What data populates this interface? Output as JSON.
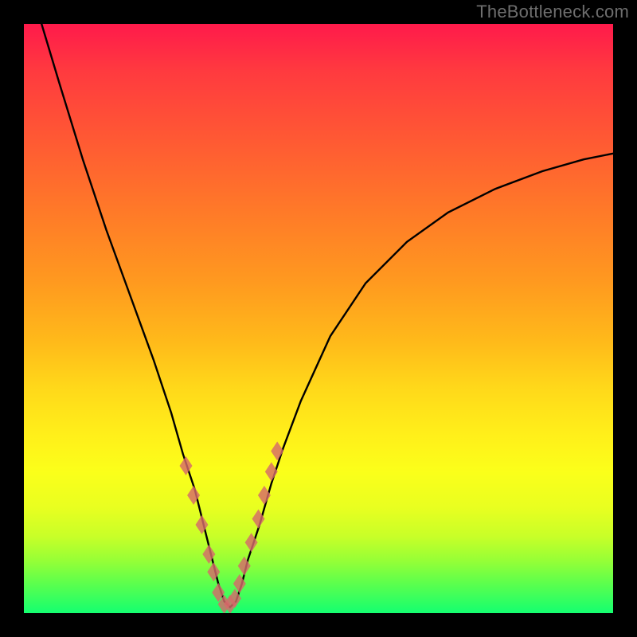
{
  "watermark": "TheBottleneck.com",
  "colors": {
    "frame": "#000000",
    "curve": "#000000",
    "markers": "#d66a6a",
    "gradient_top": "#ff1a4b",
    "gradient_bottom": "#14ff70"
  },
  "chart_data": {
    "type": "line",
    "title": "",
    "xlabel": "",
    "ylabel": "",
    "xlim": [
      0,
      100
    ],
    "ylim": [
      0,
      100
    ],
    "series": [
      {
        "name": "bottleneck-curve",
        "x": [
          3,
          6,
          10,
          14,
          18,
          22,
          25,
          27,
          29,
          30.5,
          32,
          33,
          34,
          35,
          36,
          37,
          38,
          40,
          42,
          44,
          47,
          52,
          58,
          65,
          72,
          80,
          88,
          95,
          100
        ],
        "values": [
          100,
          90,
          77,
          65,
          54,
          43,
          34,
          27,
          21,
          15,
          9,
          5,
          2,
          1,
          2,
          5,
          9,
          15,
          22,
          28,
          36,
          47,
          56,
          63,
          68,
          72,
          75,
          77,
          78
        ]
      }
    ],
    "markers": {
      "name": "highlighted-points",
      "shape": "lozenge",
      "x": [
        27.5,
        28.8,
        30.2,
        31.4,
        32.2,
        33.0,
        34.0,
        35.0,
        35.8,
        36.6,
        37.4,
        38.6,
        39.8,
        40.8,
        42.0,
        43.0
      ],
      "values": [
        25,
        20,
        15,
        10,
        7,
        3.5,
        1.5,
        1.5,
        2.5,
        5,
        8,
        12,
        16,
        20,
        24,
        27.5
      ]
    }
  }
}
